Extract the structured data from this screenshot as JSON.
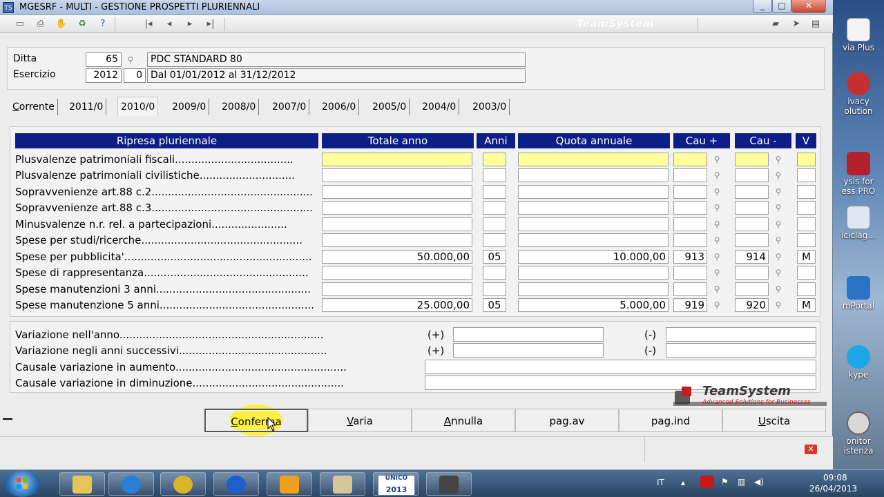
{
  "window": {
    "title": "MGESRF  - MULTI -  GESTIONE PROSPETTI PLURIENNALI",
    "app_icon": "TS",
    "controls": [
      "minimize",
      "maximize",
      "close"
    ]
  },
  "toolbar": {
    "icons": [
      "screen-icon",
      "printer-icon",
      "hand-icon",
      "recycle-icon",
      "help-icon"
    ],
    "nav": [
      "first-icon",
      "prev-icon",
      "next-icon",
      "last-icon"
    ],
    "brand": "TeamSystem"
  },
  "header": {
    "ditta_label": "Ditta",
    "ditta_code": "65",
    "ditta_desc": "PDC STANDARD 80",
    "esercizio_label": "Esercizio",
    "esercizio_year": "2012",
    "esercizio_num": "0",
    "esercizio_desc": "Dal 01/01/2012 al 31/12/2012"
  },
  "tabs": [
    {
      "label": "Corrente",
      "active": false
    },
    {
      "label": "2011/0",
      "active": false
    },
    {
      "label": "2010/0",
      "active": true
    },
    {
      "label": "2009/0",
      "active": false
    },
    {
      "label": "2008/0",
      "active": false
    },
    {
      "label": "2007/0",
      "active": false
    },
    {
      "label": "2006/0",
      "active": false
    },
    {
      "label": "2005/0",
      "active": false
    },
    {
      "label": "2004/0",
      "active": false
    },
    {
      "label": "2003/0",
      "active": false
    }
  ],
  "grid": {
    "headers": {
      "ripresa": "Ripresa pluriennale",
      "totale": "Totale anno",
      "anni": "Anni",
      "quota": "Quota annuale",
      "cau_plus": "Cau +",
      "cau_minus": "Cau -",
      "v": "V"
    },
    "rows": [
      {
        "label": "Plusvalenze patrimoniali fiscali....................................",
        "totale": "",
        "anni": "",
        "quota": "",
        "cau_plus": "",
        "cau_minus": "",
        "v": ""
      },
      {
        "label": "Plusvalenze patrimoniali civilistiche.............................",
        "totale": "",
        "anni": "",
        "quota": "",
        "cau_plus": "",
        "cau_minus": "",
        "v": ""
      },
      {
        "label": "Sopravvenienze art.88 c.2.................................................",
        "totale": "",
        "anni": "",
        "quota": "",
        "cau_plus": "",
        "cau_minus": "",
        "v": ""
      },
      {
        "label": "Sopravvenienze art.88 c.3.................................................",
        "totale": "",
        "anni": "",
        "quota": "",
        "cau_plus": "",
        "cau_minus": "",
        "v": ""
      },
      {
        "label": "Minusvalenze n.r. rel. a partecipazioni.......................",
        "totale": "",
        "anni": "",
        "quota": "",
        "cau_plus": "",
        "cau_minus": "",
        "v": ""
      },
      {
        "label": "Spese per studi/ricerche.................................................",
        "totale": "",
        "anni": "",
        "quota": "",
        "cau_plus": "",
        "cau_minus": "",
        "v": ""
      },
      {
        "label": "Spese per pubblicita'.........................................................",
        "totale": "50.000,00",
        "anni": "05",
        "quota": "10.000,00",
        "cau_plus": "913",
        "cau_minus": "914",
        "v": "M"
      },
      {
        "label": "Spese di rappresentanza..................................................",
        "totale": "",
        "anni": "",
        "quota": "",
        "cau_plus": "",
        "cau_minus": "",
        "v": ""
      },
      {
        "label": "Spese manutenzioni 3 anni...............................................",
        "totale": "",
        "anni": "",
        "quota": "",
        "cau_plus": "",
        "cau_minus": "",
        "v": ""
      },
      {
        "label": "Spese manutenzione 5 anni...............................................",
        "totale": "25.000,00",
        "anni": "05",
        "quota": "5.000,00",
        "cau_plus": "919",
        "cau_minus": "920",
        "v": "M"
      }
    ]
  },
  "variazioni": {
    "row1_label": "Variazione nell'anno..............................................................",
    "row2_label": "Variazione negli anni successivi.............................................",
    "row3_label": "Causale variazione in aumento....................................................",
    "row4_label": "Causale variazione in diminuzione..............................................",
    "plus": "(+)",
    "minus": "(-)"
  },
  "logo": {
    "text": "TeamSystem",
    "subtitle": "Advanced Solutions for Businesses"
  },
  "buttons": {
    "conferma": "Conferma",
    "varia": "Varia",
    "annulla": "Annulla",
    "pag_av": "pag.av",
    "pag_ind": "pag.ind",
    "uscita": "Uscita"
  },
  "desktop": {
    "icons": [
      {
        "label": "via Plus"
      },
      {
        "label": "ivacy\nolution"
      },
      {
        "label": "ysis for\ness PRO"
      },
      {
        "label": "iciclag..."
      },
      {
        "label": "mPortal"
      },
      {
        "label": "kype"
      },
      {
        "label": "onitor\nistenza"
      }
    ]
  },
  "taskbar": {
    "lang": "IT",
    "time": "09:08",
    "date": "26/04/2013",
    "unico_label": "UNICO",
    "unico_year": "2013"
  },
  "colors": {
    "header_blue": "#0d1f86",
    "highlight_yellow": "#ffff9c",
    "focus_circle": "#fff028"
  }
}
